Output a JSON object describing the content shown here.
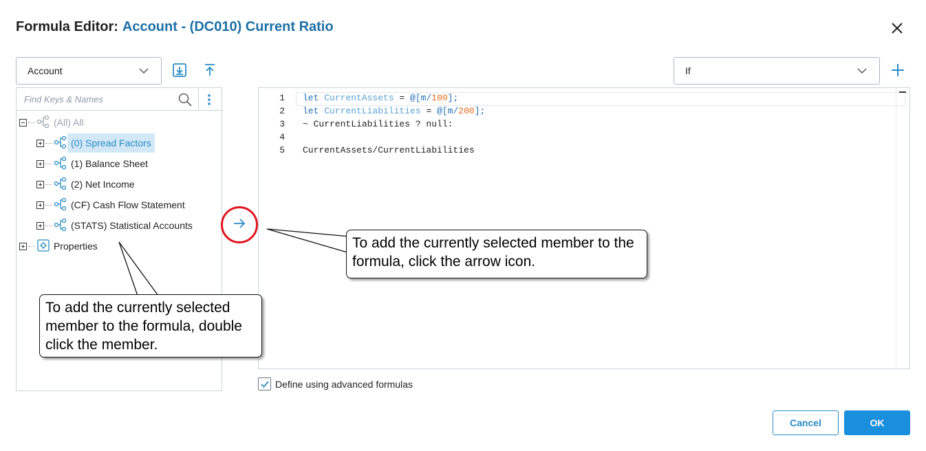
{
  "dialog": {
    "title_label": "Formula Editor:",
    "title_value": "Account - (DC010) Current Ratio"
  },
  "dimension_select": {
    "value": "Account"
  },
  "function_select": {
    "value": "If"
  },
  "search": {
    "placeholder": "Find Keys & Names"
  },
  "tree": {
    "root": "(All) All",
    "items": [
      "(0) Spread Factors",
      "(1) Balance Sheet",
      "(2) Net Income",
      "(CF) Cash Flow Statement",
      "(STATS) Statistical Accounts"
    ],
    "properties": "Properties"
  },
  "editor": {
    "line_numbers": [
      "1",
      "2",
      "3",
      "4",
      "5"
    ],
    "line1": {
      "kw": "let ",
      "var": "CurrentAssets",
      "eq": " = ",
      "at": "@[",
      "path": "m/",
      "num": "100",
      "end": "];"
    },
    "line2": {
      "kw": "let ",
      "var": "CurrentLiabilities",
      "eq": " = ",
      "at": "@[",
      "path": "m/",
      "num": "200",
      "end": "];"
    },
    "line3": "~ CurrentLiabilities ? null:",
    "line5": "CurrentAssets/CurrentLiabilities"
  },
  "callouts": {
    "right": "To add the currently selected member to the formula, click the arrow icon.",
    "left": "To add the currently selected member to the formula, double click the member."
  },
  "checkbox": {
    "label": "Define using advanced formulas",
    "checked": true
  },
  "buttons": {
    "cancel": "Cancel",
    "ok": "OK"
  },
  "colors": {
    "accent": "#1a8fde",
    "highlight": "#e0141e",
    "title_value": "#1d6fa5"
  }
}
